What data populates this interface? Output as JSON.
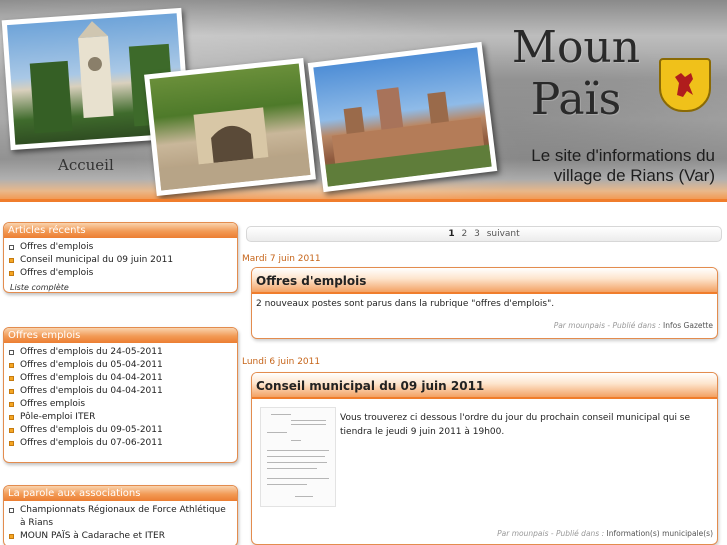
{
  "banner": {
    "title_line1": "Moun",
    "title_line2": "Païs",
    "subtitle_line1": "Le site d'informations du",
    "subtitle_line2": "village de Rians (Var)",
    "accueil": "Accueil"
  },
  "sidebar": {
    "recent": {
      "title": "Articles récents",
      "items": [
        "Offres d'emplois",
        "Conseil municipal du 09 juin 2011",
        "Offres d'emplois"
      ],
      "more": "Liste complète"
    },
    "jobs": {
      "title": "Offres emplois",
      "items": [
        "Offres d'emplois du 24-05-2011",
        "Offres d'emplois du 05-04-2011",
        "Offres d'emplois du 04-04-2011",
        "Offres d'emplois du 04-04-2011",
        "Offres emplois",
        "Pôle-emploi ITER",
        "Offres d'emplois du 09-05-2011",
        "Offres d'emplois du 07-06-2011"
      ]
    },
    "assoc": {
      "title": "La parole aux associations",
      "items": [
        "Championnats Régionaux de Force Athlétique à Rians",
        "MOUN PAÏS à Cadarache et ITER"
      ]
    }
  },
  "pager": {
    "current": "1",
    "pages": [
      "2",
      "3"
    ],
    "next": "suivant"
  },
  "posts": [
    {
      "date": "Mardi 7 juin 2011",
      "title": "Offres d'emplois",
      "body": "2 nouveaux postes sont parus dans la rubrique \"offres d'emplois\".",
      "author": "Par mounpais",
      "published": "- Publié dans :",
      "category": "Infos Gazette"
    },
    {
      "date": "Lundi 6 juin 2011",
      "title": "Conseil municipal du 09 juin 2011",
      "body": "Vous trouverez ci dessous l'ordre du jour du prochain conseil municipal qui se tiendra le jeudi 9 juin 2011 à 19h00.",
      "author": "Par mounpais",
      "published": "- Publié dans :",
      "category": "Information(s) municipale(s)"
    }
  ],
  "colors": {
    "accent": "#f07d2c",
    "date": "#c6651a"
  }
}
